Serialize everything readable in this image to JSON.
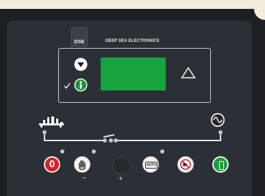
{
  "brand": {
    "logo_text": "DSE",
    "name": "DEEP SEA ELECTRONICS"
  },
  "buttons": {
    "stop_label": "0",
    "manual_sign": "−",
    "start_sign": "+",
    "auto_label": "AUTO"
  },
  "colors": {
    "lcd_green": "#17a33d",
    "stop_red": "#d81f26",
    "mains_green": "#1e9b3b",
    "panel": "#2b3036"
  },
  "icons": {
    "scroll_up": "up-triangle-icon",
    "scroll_down": "down-arrow-icon",
    "info": "info-icon",
    "ok": "checkmark-icon",
    "generator": "generator-icon",
    "mains": "mains-sine-icon"
  }
}
